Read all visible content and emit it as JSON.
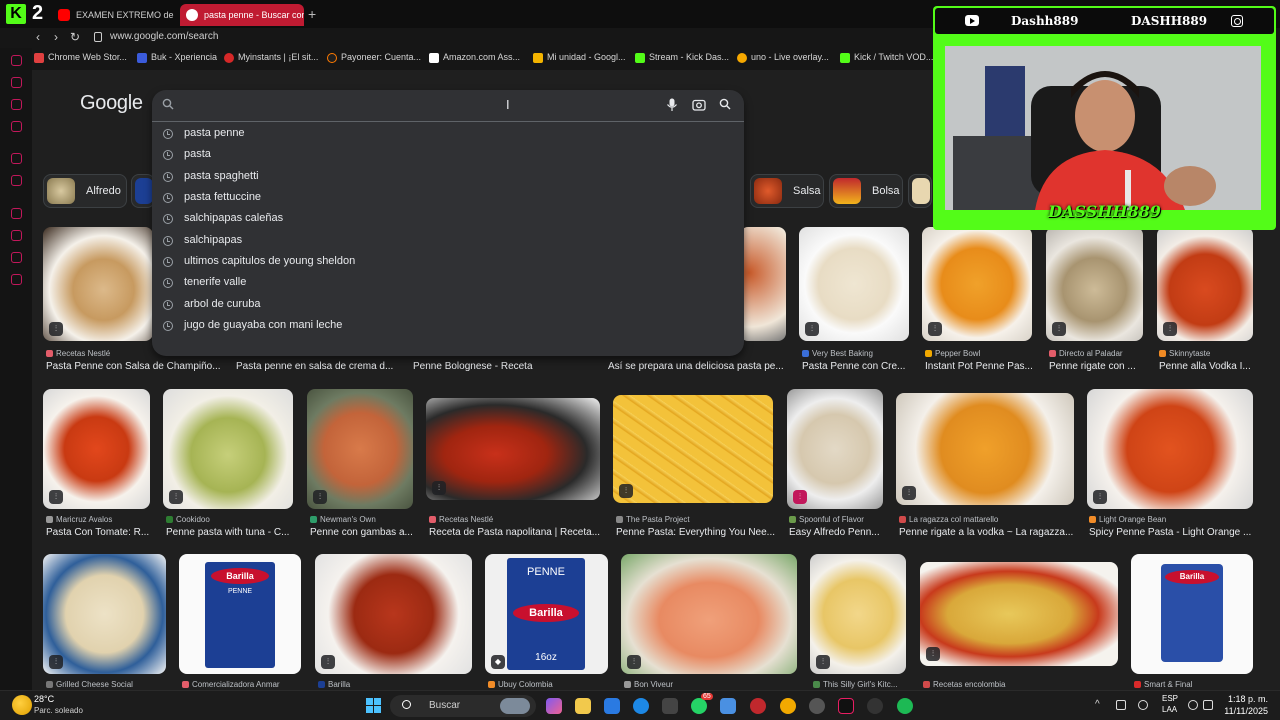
{
  "browser": {
    "tabs": [
      {
        "label": "EXAMEN EXTREMO de C"
      },
      {
        "label": "pasta penne - Buscar con"
      }
    ],
    "stream_count": "2",
    "url": "www.google.com/search",
    "bookmarks": [
      "Chrome Web Stor...",
      "Buk - Xperiencia",
      "Myinstants | ¡El sit...",
      "Payoneer: Cuenta...",
      "Amazon.com Ass...",
      "Mi unidad - Googl...",
      "Stream - Kick Das...",
      "uno - Live overlay...",
      "Kick / Twitch VOD..."
    ]
  },
  "google": {
    "logo": "Google",
    "search": {
      "value": "",
      "placeholder": ""
    },
    "suggestions": [
      "pasta penne",
      "pasta",
      "pasta spaghetti",
      "pasta fettuccine",
      "salchipapas caleñas",
      "salchipapas",
      "ultimos capitulos de young sheldon",
      "tenerife valle",
      "arbol de curuba",
      "jugo de guayaba con mani leche"
    ],
    "chips": [
      "Alfredo",
      "Salsa",
      "Bolsa"
    ],
    "row1": [
      {
        "source": "Recetas Nestlé",
        "caption": "Pasta Penne con Salsa de Champiño..."
      },
      {
        "source": "",
        "caption": "Pasta penne en salsa de crema d..."
      },
      {
        "source": "",
        "caption": "Penne Bolognese - Receta"
      },
      {
        "source": "",
        "caption": "Así se prepara una deliciosa pasta pe..."
      },
      {
        "source": "Very Best Baking",
        "caption": "Pasta Penne con Cre..."
      },
      {
        "source": "Pepper Bowl",
        "caption": "Instant Pot Penne Pas..."
      },
      {
        "source": "Directo al Paladar",
        "caption": "Penne rigate con ..."
      },
      {
        "source": "Skinnytaste",
        "caption": "Penne alla Vodka I..."
      }
    ],
    "row2": [
      {
        "source": "Maricruz Avalos",
        "caption": "Pasta Con Tomate: R..."
      },
      {
        "source": "Cookidoo",
        "caption": "Penne pasta with tuna - C..."
      },
      {
        "source": "Newman's Own",
        "caption": "Penne con gambas a..."
      },
      {
        "source": "Recetas Nestlé",
        "caption": "Receta de Pasta napolitana | Receta..."
      },
      {
        "source": "The Pasta Project",
        "caption": "Penne Pasta: Everything You Nee..."
      },
      {
        "source": "Spoonful of Flavor",
        "caption": "Easy Alfredo Penn..."
      },
      {
        "source": "La ragazza col mattarello",
        "caption": "Penne rigate a la vodka ~ La ragazza..."
      },
      {
        "source": "Light Orange Bean",
        "caption": "Spicy Penne Pasta - Light Orange ..."
      }
    ],
    "row3": [
      {
        "source": "Grilled Cheese Social"
      },
      {
        "source": "Comercializadora Anmar"
      },
      {
        "source": "Barilla"
      },
      {
        "source": "Ubuy Colombia"
      },
      {
        "source": "Bon Viveur"
      },
      {
        "source": "This Silly Girl's Kitc..."
      },
      {
        "source": "Recetas encolombia"
      },
      {
        "source": "Smart & Final"
      }
    ],
    "package_labels": {
      "brand": "Barilla",
      "penne": "PENNE",
      "weight": "16oz"
    }
  },
  "stream_overlay": {
    "name_left": "Dashh889",
    "name_right": "DASHH889",
    "label": "DASSHH889"
  },
  "taskbar": {
    "temperature": "28°C",
    "condition": "Parc. soleado",
    "search_label": "Buscar",
    "badge": "65",
    "lang1": "ESP",
    "lang2": "LAA",
    "time": "1:18 p. m.",
    "date": "11/11/2025"
  }
}
